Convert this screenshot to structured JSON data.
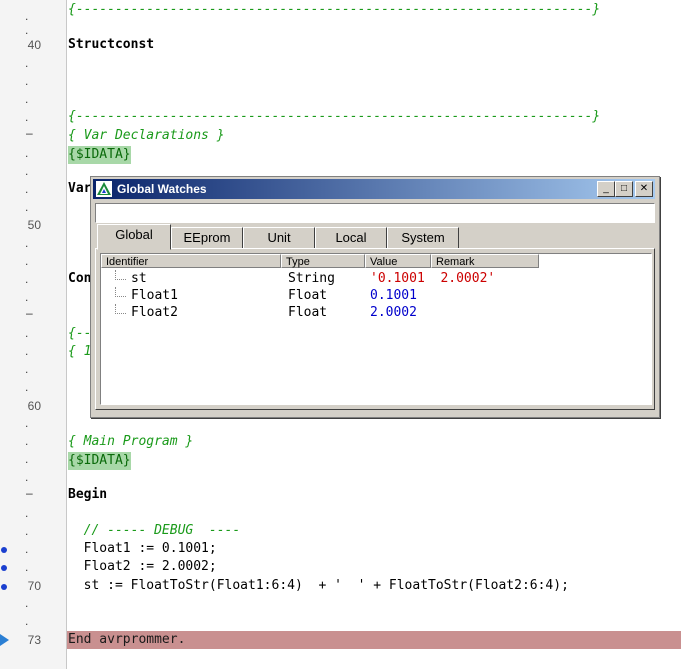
{
  "gutter": {
    "line_40": "40",
    "line_50": "50",
    "line_60": "60",
    "line_70": "70",
    "line_73": "73"
  },
  "code": {
    "top_comment_rule": "{------------------------------------------------------------------}",
    "structconst": "Structconst",
    "var_decl_rule": "{------------------------------------------------------------------}",
    "var_decl_comment": "{ Var Declarations }",
    "idata1": "{$IDATA}",
    "var_kw": "Var",
    "con_kw": "Con",
    "comment_frag1": "{--",
    "comment_frag2": "{ 1",
    "main_program_comment": "{ Main Program }",
    "idata2": "{$IDATA}",
    "begin": "Begin",
    "debug_comment": "  // ----- DEBUG  ----",
    "float1_assign": "  Float1 := 0.1001;",
    "float2_assign": "  Float2 := 2.0002;",
    "st_assign": "  st := FloatToStr(Float1:6:4)  + '  ' + FloatToStr(Float2:6:4);",
    "end_line": "End avrprommer."
  },
  "watch_window": {
    "title": "Global Watches",
    "minimize": "_",
    "maximize": "□",
    "close": "✕",
    "input_value": "",
    "tabs": [
      "Global",
      "EEprom",
      "Unit",
      "Local",
      "System"
    ],
    "active_tab": "Global",
    "columns": [
      "Identifier",
      "Type",
      "Value",
      "Remark"
    ],
    "rows": [
      {
        "identifier": "st",
        "type": "String",
        "value": "'0.1001  2.0002'"
      },
      {
        "identifier": "Float1",
        "type": "Float",
        "value": "0.1001"
      },
      {
        "identifier": "Float2",
        "type": "Float",
        "value": "2.0002"
      }
    ]
  },
  "colors": {
    "comment": "#1a9a1a",
    "directive_bg": "#a8d8a8",
    "end_line_bg": "#c99090",
    "string_value": "#cc0000",
    "numeric_value": "#0000cc",
    "title_bar": "#0a246a"
  }
}
